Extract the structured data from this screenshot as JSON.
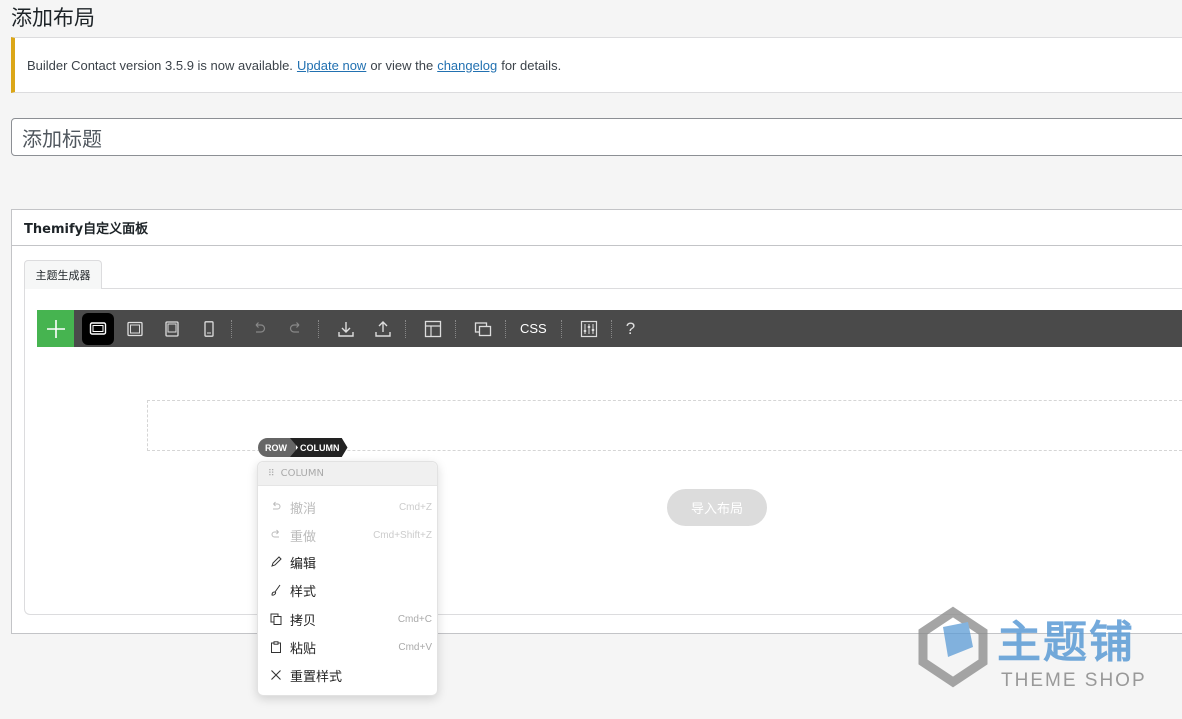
{
  "page": {
    "title": "添加布局"
  },
  "notice": {
    "text_before": "Builder Contact version 3.5.9 is now available.",
    "link_update": "Update now",
    "text_middle": "or view the",
    "link_changelog": "changelog",
    "text_after": "for details.",
    "accent_color": "#dba617"
  },
  "title_field": {
    "placeholder": "添加标题"
  },
  "panel": {
    "title": "Themify自定义面板",
    "tab_label": "主题生成器"
  },
  "toolbar": {
    "add_icon": "plus-icon",
    "accent_color": "#46b450",
    "css_label": "CSS",
    "help_label": "?"
  },
  "breadcrumb": {
    "row": "ROW",
    "column": "COLUMN"
  },
  "import_button": {
    "label": "导入布局"
  },
  "context_menu": {
    "header": "COLUMN",
    "items": [
      {
        "label": "撤消",
        "shortcut": "Cmd+Z",
        "icon": "undo-icon",
        "disabled": true
      },
      {
        "label": "重做",
        "shortcut": "Cmd+Shift+Z",
        "icon": "redo-icon",
        "disabled": true
      },
      {
        "label": "编辑",
        "shortcut": "",
        "icon": "pencil-icon",
        "disabled": false
      },
      {
        "label": "样式",
        "shortcut": "",
        "icon": "brush-icon",
        "disabled": false
      },
      {
        "label": "拷贝",
        "shortcut": "Cmd+C",
        "icon": "copy-icon",
        "disabled": false
      },
      {
        "label": "粘贴",
        "shortcut": "Cmd+V",
        "icon": "paste-icon",
        "disabled": false
      },
      {
        "label": "重置样式",
        "shortcut": "",
        "icon": "close-icon",
        "disabled": false
      }
    ]
  },
  "watermark": {
    "text": "主题铺",
    "subtext": "THEME SHOP"
  }
}
